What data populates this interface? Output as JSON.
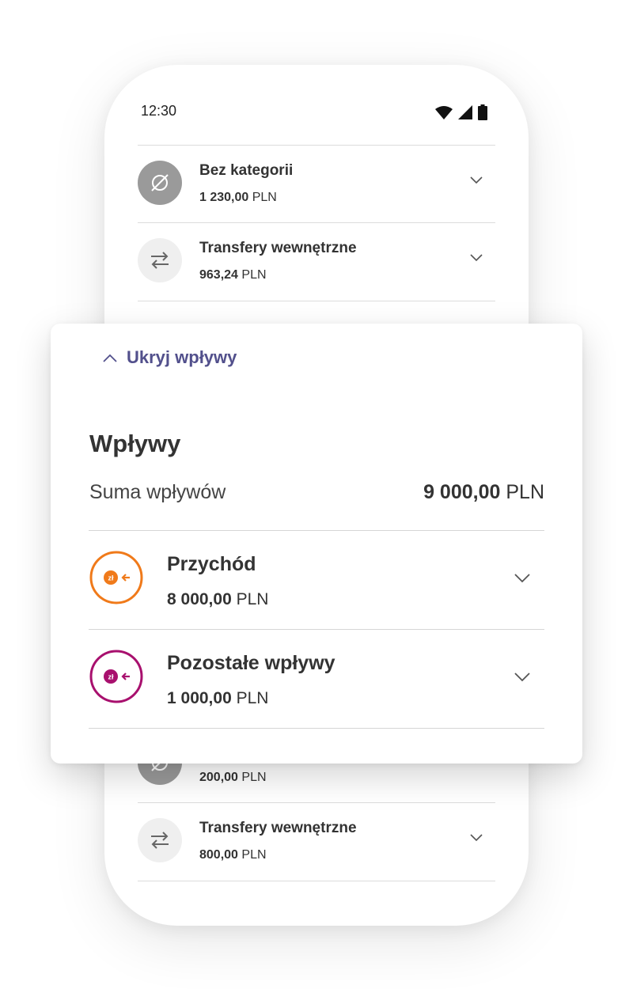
{
  "status_bar": {
    "time": "12:30"
  },
  "background_list": {
    "top_rows": [
      {
        "title": "Bez kategorii",
        "amount": "1 230,00",
        "currency": "PLN",
        "icon": "no-category-icon"
      },
      {
        "title": "Transfery wewnętrzne",
        "amount": "963,24",
        "currency": "PLN",
        "icon": "transfer-arrows-icon"
      }
    ],
    "bottom_rows": [
      {
        "title": "",
        "amount": "200,00",
        "currency": "PLN",
        "icon": "no-category-icon"
      },
      {
        "title": "Transfery wewnętrzne",
        "amount": "800,00",
        "currency": "PLN",
        "icon": "transfer-arrows-icon"
      }
    ]
  },
  "income_card": {
    "collapse_label": "Ukryj wpływy",
    "title": "Wpływy",
    "sum_label": "Suma wpływów",
    "sum_amount": "9 000,00",
    "sum_currency": "PLN",
    "categories": [
      {
        "title": "Przychód",
        "amount": "8 000,00",
        "currency": "PLN",
        "icon": "income-zloty-icon",
        "color": "#f07a1a",
        "icon_text": "zł"
      },
      {
        "title": "Pozostałe wpływy",
        "amount": "1 000,00",
        "currency": "PLN",
        "icon": "other-income-zloty-icon",
        "color": "#a8106e",
        "icon_text": "zł"
      }
    ]
  },
  "colors": {
    "accent": "#52508c",
    "income": "#f07a1a",
    "other_income": "#a8106e"
  }
}
